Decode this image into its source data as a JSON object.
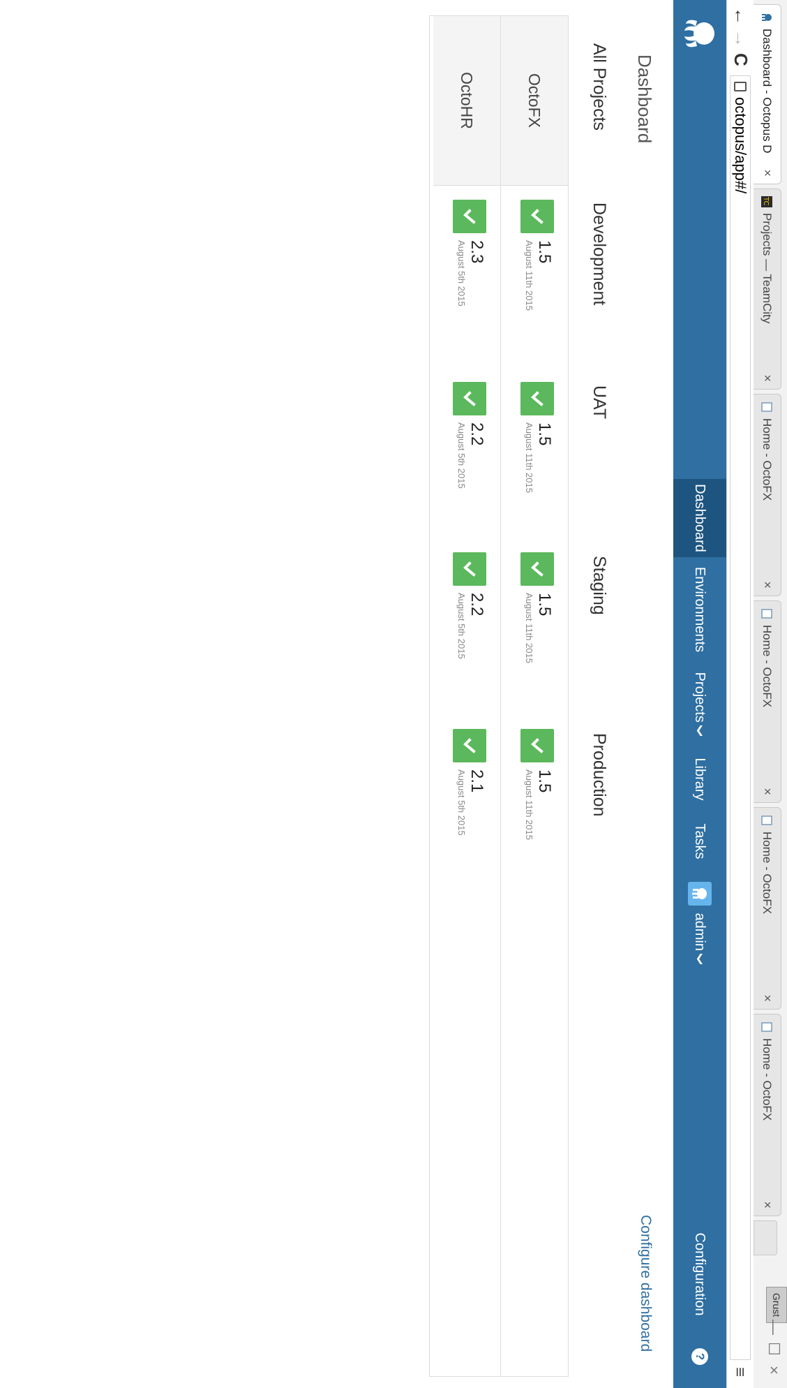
{
  "browser": {
    "tabs": [
      {
        "title": "Dashboard - Octopus D",
        "icon": "octopus-icon",
        "active": true
      },
      {
        "title": "Projects — TeamCity",
        "icon": "teamcity-icon",
        "active": false
      },
      {
        "title": "Home - OctoFX",
        "icon": "page-icon",
        "active": false
      },
      {
        "title": "Home - OctoFX",
        "icon": "page-icon",
        "active": false
      },
      {
        "title": "Home - OctoFX",
        "icon": "page-icon",
        "active": false
      },
      {
        "title": "Home - OctoFX",
        "icon": "page-icon",
        "active": false
      }
    ],
    "close_glyph": "×",
    "profile_label": "Grust",
    "url": "octopus/app#/",
    "controls": {
      "back": "←",
      "forward": "→",
      "reload": "C",
      "menu": "≡"
    },
    "window": {
      "minimize": "—",
      "maximize": "☐",
      "close": "×"
    }
  },
  "appnav": {
    "items": [
      {
        "label": "Dashboard",
        "active": true
      },
      {
        "label": "Environments"
      },
      {
        "label": "Projects",
        "dropdown": true
      },
      {
        "label": "Library"
      },
      {
        "label": "Tasks"
      }
    ],
    "user": {
      "label": "admin"
    },
    "configuration_label": "Configuration",
    "help_label": "?",
    "chevron": "❯"
  },
  "page": {
    "title": "Dashboard",
    "configure_link": "Configure dashboard"
  },
  "dashboard": {
    "project_header": "All Projects",
    "environments": [
      "Development",
      "UAT",
      "Staging",
      "Production"
    ],
    "rows": [
      {
        "project": "OctoFX",
        "deployments": [
          {
            "version": "1.5",
            "date": "August 11th 2015",
            "status": "success"
          },
          {
            "version": "1.5",
            "date": "August 11th 2015",
            "status": "success"
          },
          {
            "version": "1.5",
            "date": "August 11th 2015",
            "status": "success"
          },
          {
            "version": "1.5",
            "date": "August 11th 2015",
            "status": "success"
          }
        ]
      },
      {
        "project": "OctoHR",
        "deployments": [
          {
            "version": "2.3",
            "date": "August 5th 2015",
            "status": "success"
          },
          {
            "version": "2.2",
            "date": "August 5th 2015",
            "status": "success"
          },
          {
            "version": "2.2",
            "date": "August 5th 2015",
            "status": "success"
          },
          {
            "version": "2.1",
            "date": "August 5th 2015",
            "status": "success"
          }
        ]
      }
    ]
  },
  "colors": {
    "navbar": "#2f6fa2",
    "navbar_active": "#1e5580",
    "success": "#5cb85c",
    "link": "#2f6fa2"
  }
}
